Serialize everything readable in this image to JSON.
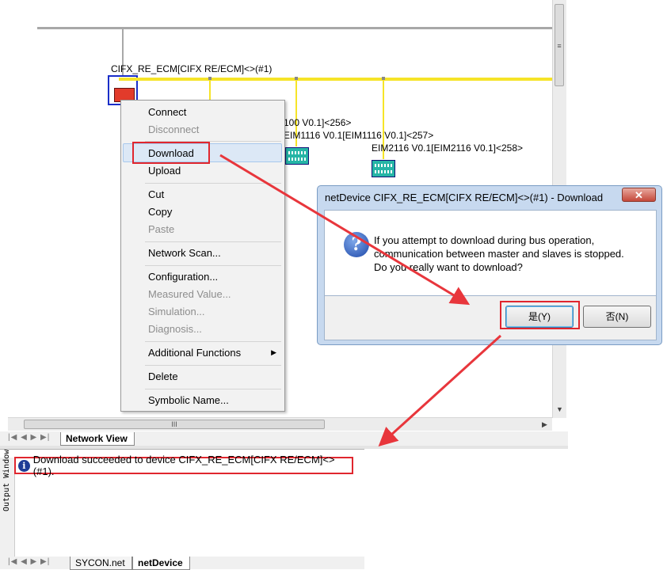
{
  "network": {
    "master_label": "CIFX_RE_ECM[CIFX RE/ECM]<>(#1)",
    "slave1_label": "100 V0.1]<256>",
    "slave2_label": "EIM1116 V0.1[EIM1116 V0.1]<257>",
    "slave3_label": "EIM2116 V0.1[EIM2116 V0.1]<258>"
  },
  "tabs": {
    "network_view": "Network View",
    "sycon": "SYCON.net",
    "netdevice": "netDevice"
  },
  "output": {
    "side_label": "Output Window",
    "message": "Download succeeded to device CIFX_RE_ECM[CIFX RE/ECM]<>(#1).",
    "info_icon_glyph": "i"
  },
  "context_menu": {
    "items": [
      {
        "label": "Connect",
        "enabled": true
      },
      {
        "label": "Disconnect",
        "enabled": false
      },
      {
        "label": "Download",
        "enabled": true
      },
      {
        "label": "Upload",
        "enabled": true
      },
      {
        "label": "Cut",
        "enabled": true
      },
      {
        "label": "Copy",
        "enabled": true
      },
      {
        "label": "Paste",
        "enabled": false
      },
      {
        "label": "Network Scan...",
        "enabled": true
      },
      {
        "label": "Configuration...",
        "enabled": true
      },
      {
        "label": "Measured Value...",
        "enabled": false
      },
      {
        "label": "Simulation...",
        "enabled": false
      },
      {
        "label": "Diagnosis...",
        "enabled": false
      },
      {
        "label": "Additional Functions",
        "enabled": true
      },
      {
        "label": "Delete",
        "enabled": true
      },
      {
        "label": "Symbolic Name...",
        "enabled": true
      }
    ],
    "submenu_arrow": "▶"
  },
  "dialog": {
    "title": "netDevice CIFX_RE_ECM[CIFX RE/ECM]<>(#1) - Download",
    "close_glyph": "✕",
    "question_glyph": "?",
    "lines": [
      "If you attempt to download during bus operation,",
      "communication between master and slaves is stopped.",
      "Do you really want to download?"
    ],
    "yes_label": "是(Y)",
    "no_label": "否(N)"
  },
  "scrollbar": {
    "grip_glyph": "≡",
    "hgrip_glyph": "III",
    "up": "▲",
    "down": "▼",
    "left": "◀",
    "right": "▶",
    "nav": "|◀ ◀ ▶ ▶|"
  },
  "colors": {
    "bus_yellow": "#f6e428",
    "highlight_red": "#e0262e",
    "arrow_red": "#e8363c",
    "slave_teal": "#26b5a6"
  }
}
